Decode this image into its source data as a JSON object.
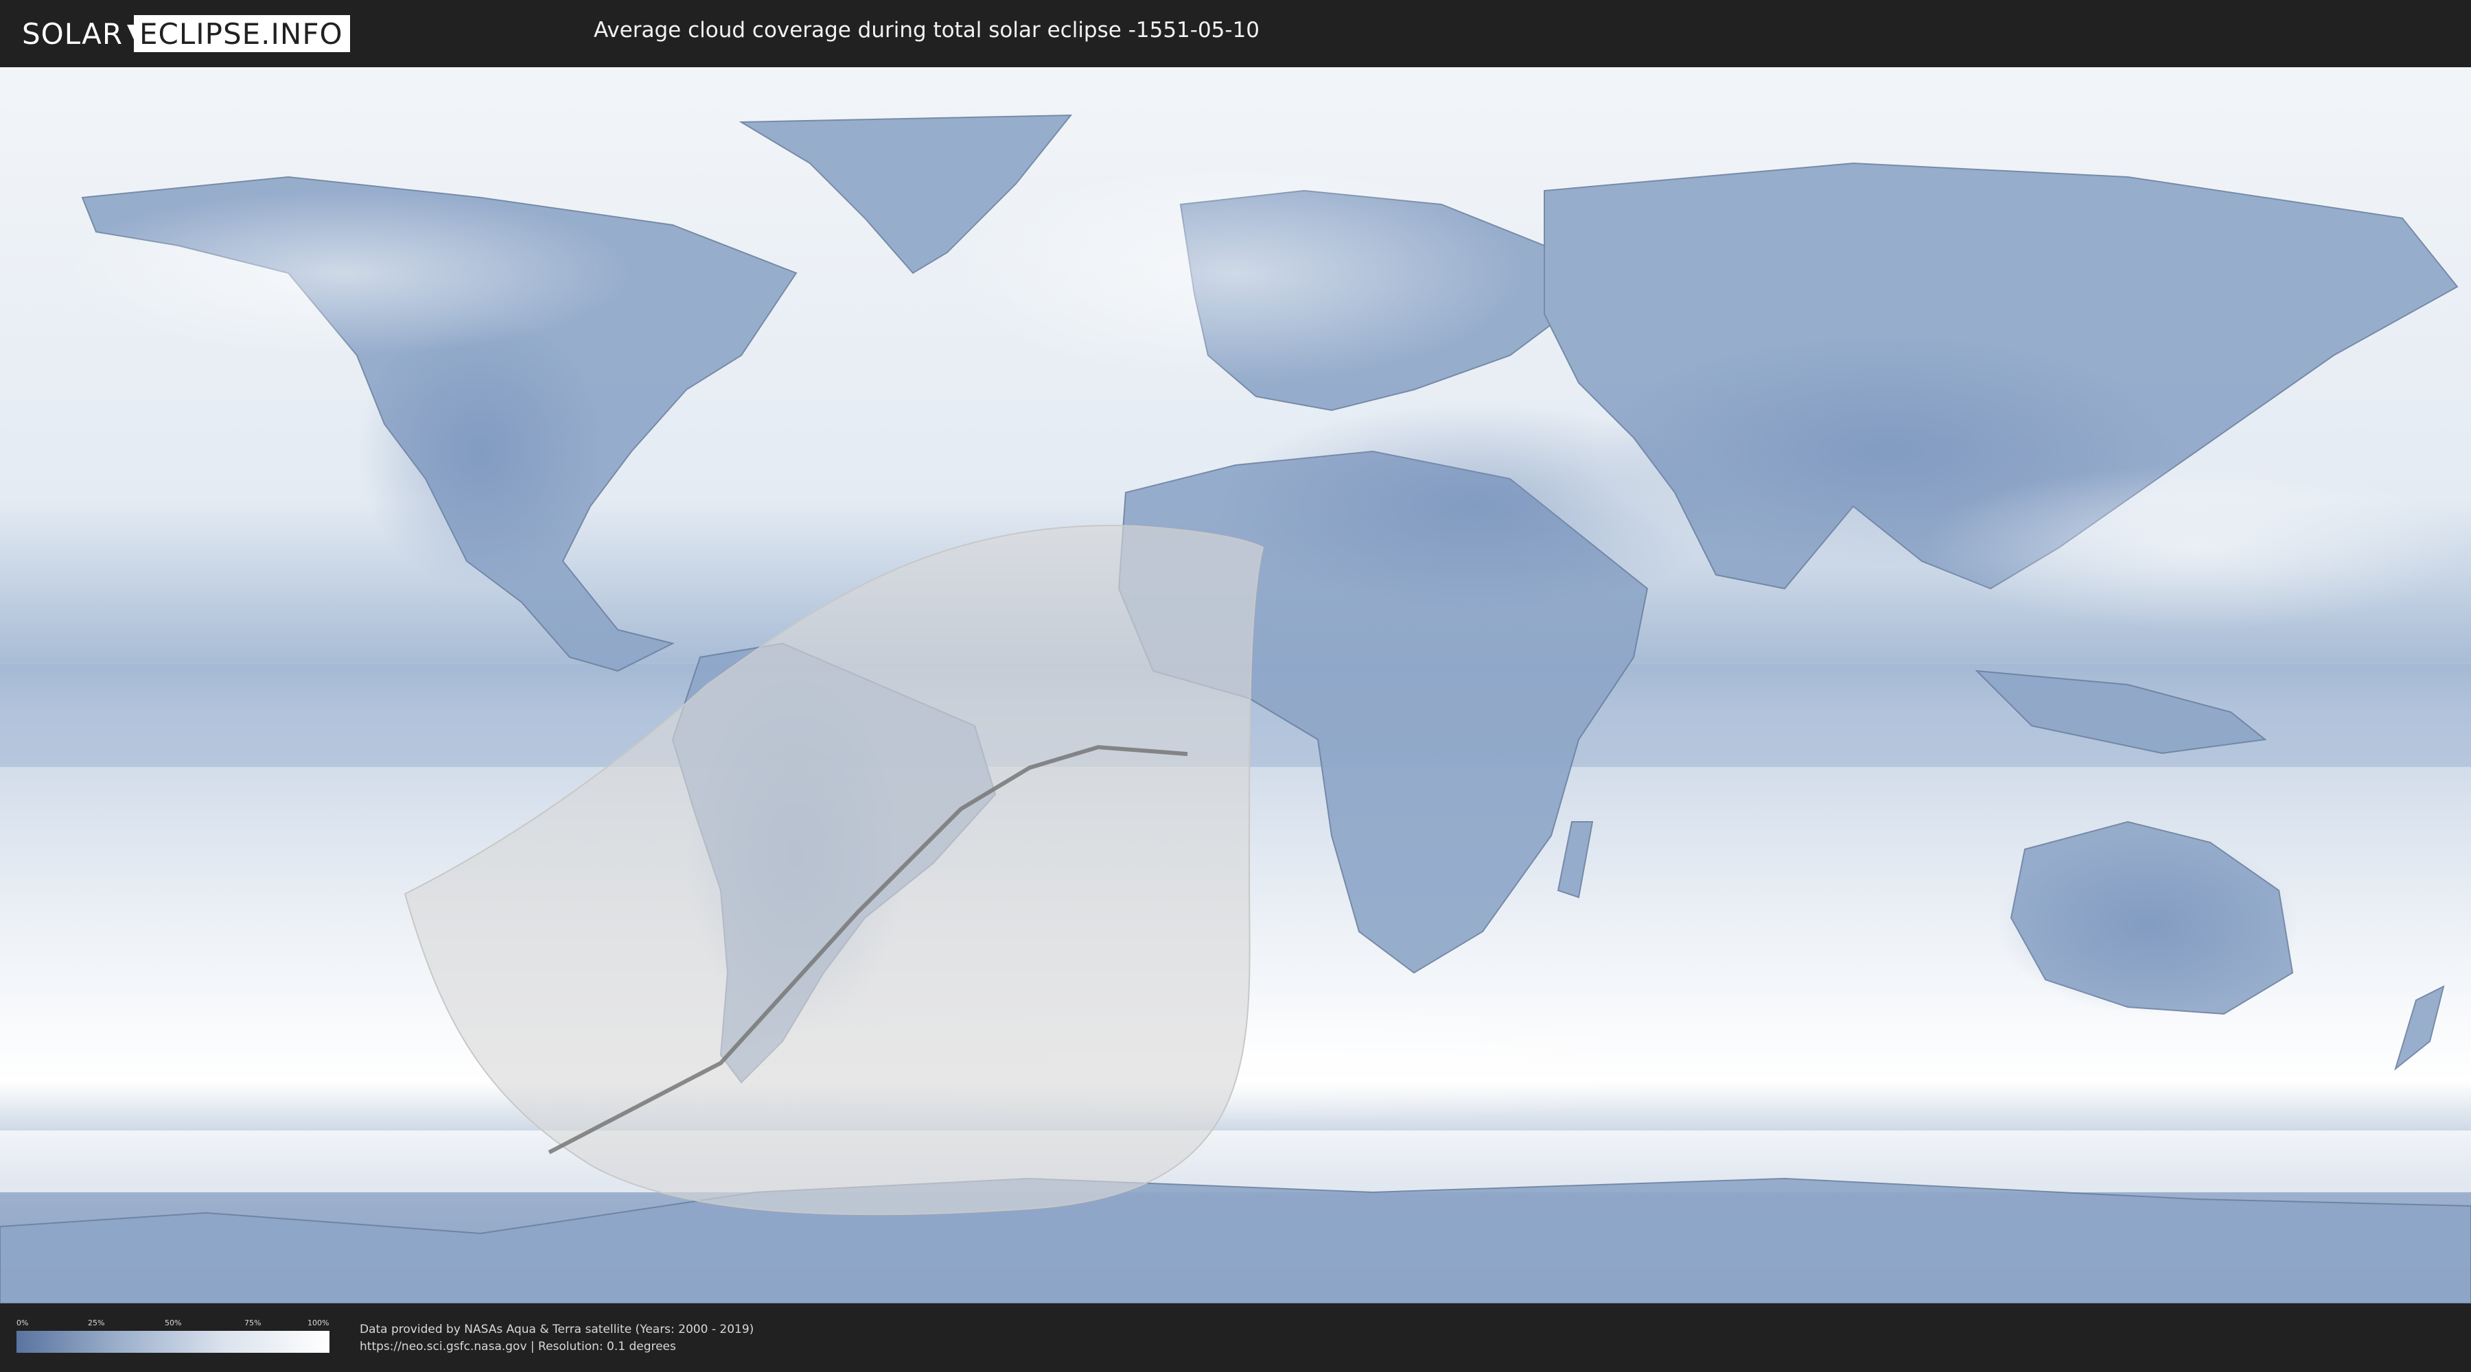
{
  "header": {
    "logo_left": "SOLAR",
    "logo_right": "ECLIPSE.INFO",
    "title": "Average cloud coverage during total solar eclipse -1551-05-10"
  },
  "map": {
    "projection": "equirectangular",
    "ocean_color": "#e9eef4",
    "land_cloud_color": "#7f99bf",
    "eclipse_shadow_color": "#d8d8d8",
    "central_line_color": "#777777",
    "central_line": [
      {
        "lon": -100,
        "lat": -68
      },
      {
        "lon": -75,
        "lat": -55
      },
      {
        "lon": -55,
        "lat": -33
      },
      {
        "lon": -40,
        "lat": -18
      },
      {
        "lon": -30,
        "lat": -12
      },
      {
        "lon": -20,
        "lat": -9
      },
      {
        "lon": -7,
        "lat": -10
      }
    ]
  },
  "footer": {
    "legend_ticks": [
      "0%",
      "25%",
      "50%",
      "75%",
      "100%"
    ],
    "credit_line1": "Data provided by NASAs Aqua & Terra satellite (Years: 2000 - 2019)",
    "credit_line2": "https://neo.sci.gsfc.nasa.gov | Resolution: 0.1 degrees"
  }
}
